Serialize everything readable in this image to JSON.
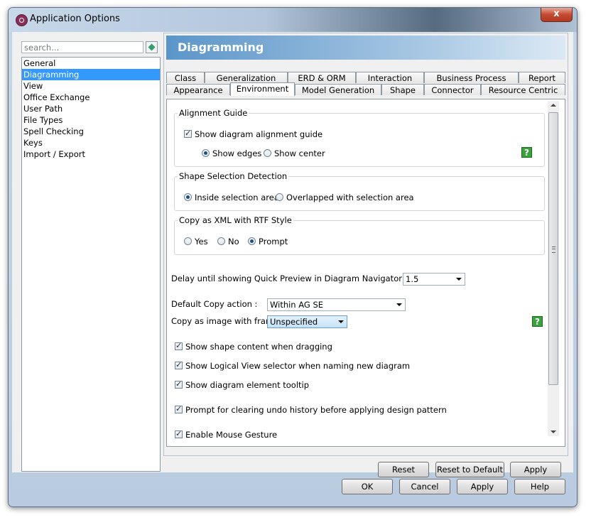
{
  "window": {
    "title": "Application Options",
    "close_glyph": "x"
  },
  "search": {
    "placeholder": "search..."
  },
  "nav": {
    "items": [
      {
        "label": "General"
      },
      {
        "label": "Diagramming"
      },
      {
        "label": "View"
      },
      {
        "label": "Office Exchange"
      },
      {
        "label": "User Path"
      },
      {
        "label": "File Types"
      },
      {
        "label": "Spell Checking"
      },
      {
        "label": "Keys"
      },
      {
        "label": "Import / Export"
      }
    ],
    "selected": "Diagramming"
  },
  "page": {
    "title": "Diagramming"
  },
  "tabs": {
    "back_row": [
      "Class",
      "Generalization",
      "ERD & ORM",
      "Interaction",
      "Business Process",
      "Report"
    ],
    "front_row": [
      "Appearance",
      "Environment",
      "Model Generation",
      "Shape",
      "Connector",
      "Resource Centric"
    ],
    "active": "Environment"
  },
  "alignment_guide": {
    "legend": "Alignment Guide",
    "show_guide": {
      "label": "Show diagram alignment guide",
      "checked": true
    },
    "options": [
      {
        "label": "Show edges",
        "selected": true
      },
      {
        "label": "Show center",
        "selected": false
      }
    ]
  },
  "shape_selection": {
    "legend": "Shape Selection Detection",
    "options": [
      {
        "label": "Inside selection area",
        "selected": true
      },
      {
        "label": "Overlapped with selection area",
        "selected": false
      }
    ]
  },
  "copy_xml": {
    "legend": "Copy as XML with RTF Style",
    "options": [
      {
        "label": "Yes",
        "selected": false
      },
      {
        "label": "No",
        "selected": false
      },
      {
        "label": "Prompt",
        "selected": true
      }
    ]
  },
  "quick_preview": {
    "label": "Delay until showing Quick Preview in Diagram Navigator (seconds) :",
    "value": "1.5"
  },
  "copy_action": {
    "label": "Default Copy action :",
    "value": "Within AG SE"
  },
  "copy_image": {
    "label": "Copy as image with frame :",
    "value": "Unspecified"
  },
  "checks": [
    {
      "label": "Show shape content when dragging",
      "checked": true
    },
    {
      "label": "Show Logical View selector when naming new diagram",
      "checked": true
    },
    {
      "label": "Show diagram element tooltip",
      "checked": true
    },
    {
      "label": "Prompt for clearing undo history before applying design pattern",
      "checked": true
    },
    {
      "label": "Enable Mouse Gesture",
      "checked": true
    }
  ],
  "help": {
    "glyph": "?"
  },
  "panel_buttons": {
    "reset": "Reset",
    "reset_default": "Reset to Default",
    "apply": "Apply"
  },
  "dialog_buttons": {
    "ok": "OK",
    "cancel": "Cancel",
    "apply": "Apply",
    "help": "Help"
  },
  "colors": {
    "selection": "#3399ff",
    "banner": "#5b95c8",
    "help_icon": "#39a23c"
  }
}
